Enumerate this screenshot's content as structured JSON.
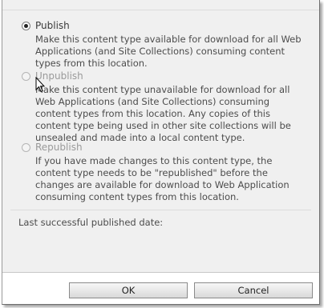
{
  "options": [
    {
      "label": "Publish",
      "checked": true,
      "enabled": true,
      "description": "Make this content type available for download for all Web Applications (and Site Collections) consuming content types from this location."
    },
    {
      "label": "Unpublish",
      "checked": false,
      "enabled": false,
      "description": "Make this content type unavailable for download for all Web Applications (and Site Collections) consuming content types from this location. Any copies of this content type being used in other site collections will be unsealed and made into a local content type."
    },
    {
      "label": "Republish",
      "checked": false,
      "enabled": false,
      "description": "If you have made changes to this content type, the content type needs to be \"republished\" before the changes are available for download to Web Application consuming content types from this location."
    }
  ],
  "last_published": {
    "label": "Last successful published date:"
  },
  "buttons": {
    "ok": "OK",
    "cancel": "Cancel"
  },
  "icons": {
    "cursor": "mouse-pointer-icon"
  },
  "colors": {
    "panel": "#f0f0f0",
    "text": "#4c4c4c",
    "disabled_text": "#9a9a9a"
  }
}
